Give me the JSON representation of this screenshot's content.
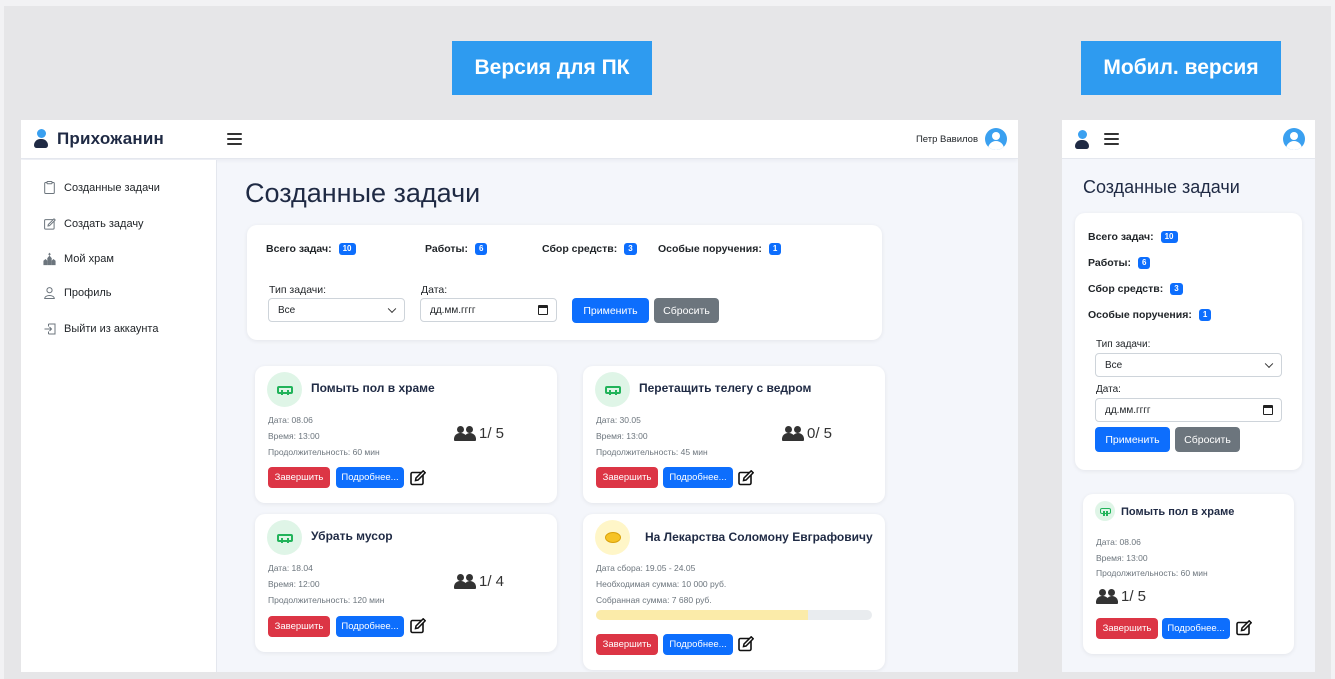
{
  "tags": {
    "pc": "Версия для ПК",
    "mobile": "Мобил. версия"
  },
  "brand": {
    "title": "Прихожанин"
  },
  "user": {
    "name": "Петр Вавилов"
  },
  "sidebar": {
    "items": [
      {
        "label": "Созданные задачи",
        "icon": "clipboard-icon"
      },
      {
        "label": "Создать задачу",
        "icon": "pencil-square-icon"
      },
      {
        "label": "Мой храм",
        "icon": "church-icon"
      },
      {
        "label": "Профиль",
        "icon": "user-icon"
      },
      {
        "label": "Выйти из аккаунта",
        "icon": "logout-icon"
      }
    ]
  },
  "page": {
    "title": "Созданные задачи"
  },
  "stats": {
    "total": {
      "label": "Всего задач:",
      "count": "10"
    },
    "work": {
      "label": "Работы:",
      "count": "6"
    },
    "funds": {
      "label": "Сбор средств:",
      "count": "3"
    },
    "special": {
      "label": "Особые поручения:",
      "count": "1"
    }
  },
  "filters": {
    "type_label": "Тип задачи:",
    "type_value": "Все",
    "date_label": "Дата:",
    "date_placeholder_desktop": "дд.мм.гггг",
    "date_placeholder_mobile": "дд.мм.гггг",
    "apply": "Применить",
    "reset": "Сбросить"
  },
  "buttons": {
    "finish": "Завершить",
    "details": "Подробнее..."
  },
  "tasks": [
    {
      "title": "Помыть пол в храме",
      "date": "Дата: 08.06",
      "time": "Время: 13:00",
      "duration": "Продолжительность: 60 мин",
      "count": "1/ 5"
    },
    {
      "title": "Перетащить телегу с ведром",
      "date": "Дата: 30.05",
      "time": "Время: 13:00",
      "duration": "Продолжительность: 45 мин",
      "count": "0/ 5"
    },
    {
      "title": "Убрать мусор",
      "date": "Дата: 18.04",
      "time": "Время: 12:00",
      "duration": "Продолжительность: 120 мин",
      "count": "1/ 4"
    },
    {
      "title": "На Лекарства Соломону Евграфовичу",
      "period": "Дата сбора: 19.05 - 24.05",
      "needed": "Необходимая сумма: 10 000 руб.",
      "collected": "Собранная сумма: 7 680 руб.",
      "progress": 0.768
    }
  ],
  "mobile_task": {
    "title": "Помыть пол в храме",
    "date": "Дата: 08.06",
    "time": "Время: 13:00",
    "duration": "Продолжительность: 60 мин",
    "count": "1/ 5"
  },
  "colors": {
    "accent": "#0d6efd",
    "danger": "#dc3545",
    "secondary": "#6c757d",
    "tag": "#2e9bf0",
    "brand_dark": "#1f2a44"
  }
}
